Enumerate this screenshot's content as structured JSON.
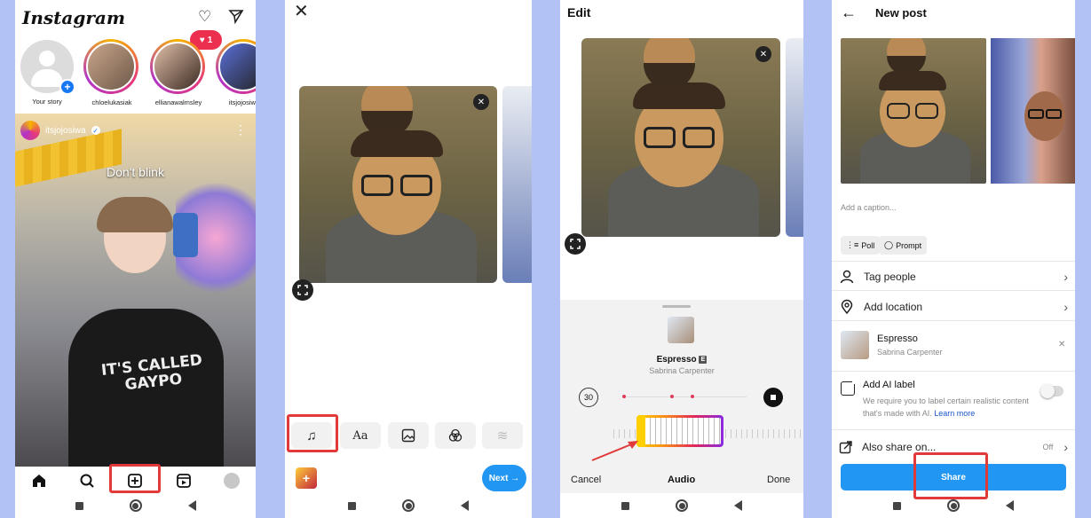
{
  "screen1": {
    "app_title": "Instagram",
    "notification_count": "1",
    "stories": [
      {
        "label": "Your story"
      },
      {
        "label": "chloelukasiak"
      },
      {
        "label": "ellianawalmsley"
      },
      {
        "label": "itsjojosiwa"
      }
    ],
    "post_author": "itsjojosiwa",
    "post_caption": "Don't blink",
    "shirt_text": "IT'S CALLED GAYPO"
  },
  "screen2": {
    "next_label": "Next →"
  },
  "screen3": {
    "title": "Edit",
    "song_title": "Espresso",
    "explicit_badge": "E",
    "artist": "Sabrina Carpenter",
    "duration": "30",
    "cancel_label": "Cancel",
    "audio_label": "Audio",
    "done_label": "Done"
  },
  "screen4": {
    "title": "New post",
    "caption_placeholder": "Add a caption...",
    "chips": [
      {
        "label": "Poll"
      },
      {
        "label": "Prompt"
      }
    ],
    "tag_people": "Tag people",
    "add_location": "Add location",
    "song_title": "Espresso",
    "artist": "Sabrina Carpenter",
    "ai_label_title": "Add AI label",
    "ai_label_desc": "We require you to label certain realistic content that's made with AI.",
    "learn_more": "Learn more",
    "also_share": "Also share on...",
    "also_share_value": "Off",
    "share_label": "Share"
  },
  "colors": {
    "accent": "#1877f2",
    "share_button": "#2196f3",
    "highlight_box": "#e03a3a",
    "notification": "#ed2f4f"
  }
}
